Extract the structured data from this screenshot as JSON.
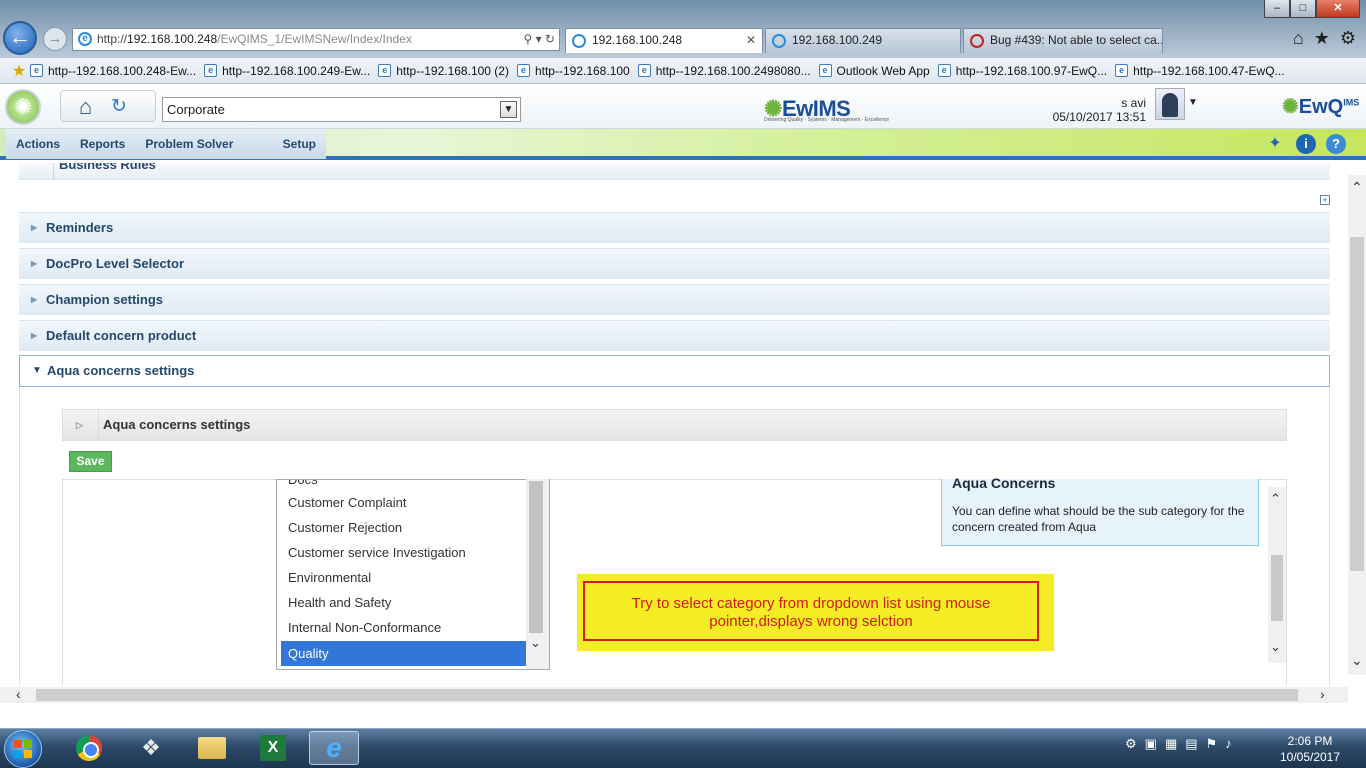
{
  "browser": {
    "address": {
      "prefix": "http://",
      "host": "192.168.100.248",
      "path": "/EwQIMS_1/EwIMSNew/Index/Index"
    },
    "tabs": [
      {
        "label": "192.168.100.248",
        "active": true
      },
      {
        "label": "192.168.100.249",
        "active": false
      },
      {
        "label": "Bug #439: Not able to select ca...",
        "active": false
      }
    ],
    "window_controls": {
      "minimize": "–",
      "maximize": "□",
      "close": "✕"
    },
    "favorites": [
      "http--192.168.100.248-Ew...",
      "http--192.168.100.249-Ew...",
      "http--192.168.100 (2)",
      "http--192.168.100",
      "http--192.168.100.2498080...",
      "Outlook Web App",
      "http--192.168.100.97-EwQ...",
      "http--192.168.100.47-EwQ..."
    ]
  },
  "app": {
    "org_select": "Corporate",
    "brand": {
      "ew": "Ew",
      "ims": "IMS",
      "tagline": "Delivering Quality · Systems · Management · Excellence"
    },
    "brand_right": {
      "main": "EwQ",
      "sup": "IMS",
      "accent": "#6cb33e"
    },
    "user": "s avi",
    "datetime": "05/10/2017 13:51",
    "menu": [
      "Actions",
      "Reports",
      "Problem Solver Setup",
      "Setup"
    ],
    "icons": {
      "pin": "pin-icon",
      "info": "info-icon",
      "help": "help-icon"
    }
  },
  "sections": {
    "partial_top": "Business Rules",
    "items": [
      "Reminders",
      "DocPro Level Selector",
      "Champion settings",
      "Default concern product",
      "Aqua concerns settings"
    ]
  },
  "aqua_panel": {
    "title": "Aqua concerns settings",
    "save_label": "Save",
    "list": {
      "partial_top": "Docs",
      "items": [
        "Customer Complaint",
        "Customer Rejection",
        "Customer service Investigation",
        "Environmental",
        "Health and Safety",
        "Internal Non-Conformance",
        "Quality"
      ],
      "selected": "Quality"
    },
    "info_box": {
      "title": "Aqua Concerns",
      "text": "You can define what should be the sub category for the concern created from Aqua"
    }
  },
  "annotation": {
    "line1": "Try to select category from dropdown list using mouse",
    "line2": "pointer,displays wrong selction"
  },
  "taskbar": {
    "clock_time": "2:06 PM",
    "clock_date": "10/05/2017",
    "apps": [
      "chrome",
      "tool",
      "folder",
      "excel",
      "internet-explorer"
    ]
  },
  "colors": {
    "accent_blue": "#2e73b8",
    "selection": "#3277d8",
    "save_green": "#5cb85c",
    "annotation_red": "#d21c1c",
    "annotation_yellow": "#f5ed24"
  }
}
